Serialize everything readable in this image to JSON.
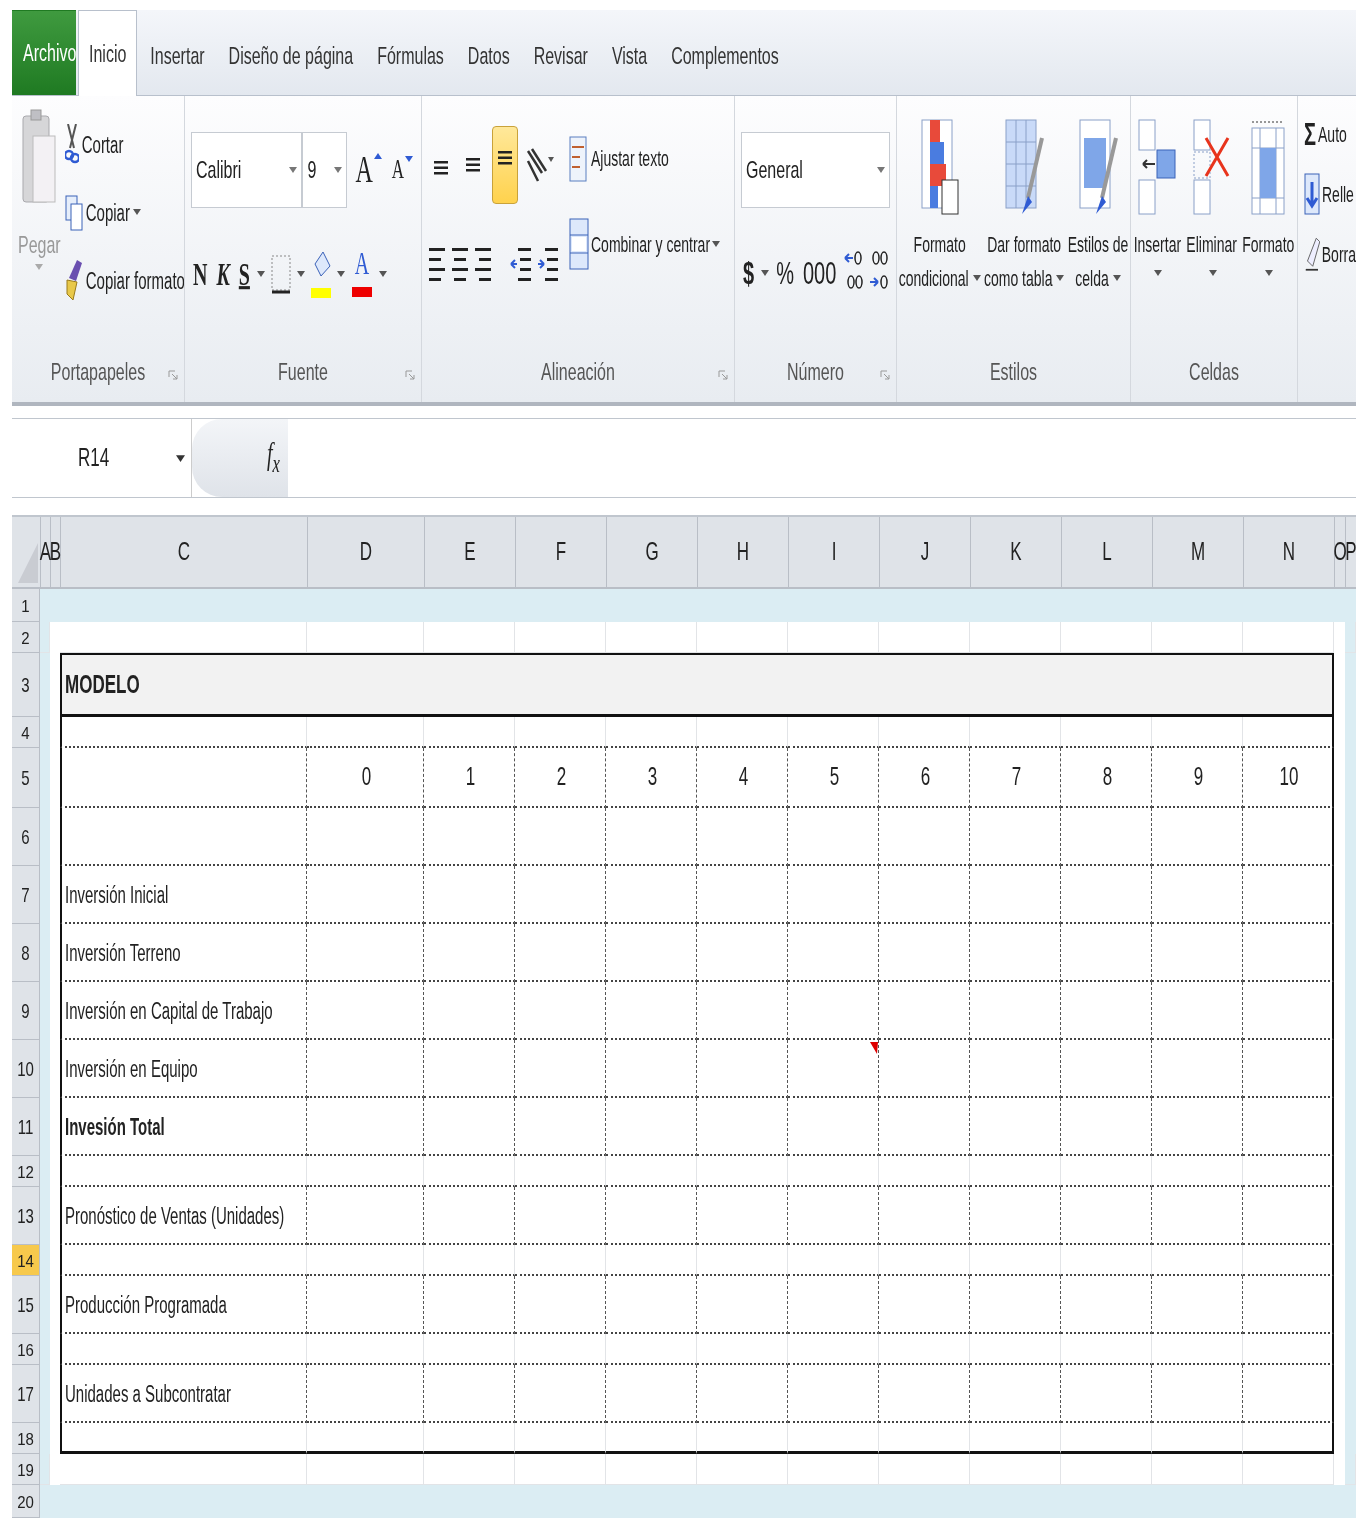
{
  "tabs": [
    {
      "label": "Archivo",
      "kind": "file",
      "selected": false
    },
    {
      "label": "Inicio",
      "kind": "tab",
      "selected": true
    },
    {
      "label": "Insertar",
      "kind": "tab",
      "selected": false
    },
    {
      "label": "Diseño de página",
      "kind": "tab",
      "selected": false
    },
    {
      "label": "Fórmulas",
      "kind": "tab",
      "selected": false
    },
    {
      "label": "Datos",
      "kind": "tab",
      "selected": false
    },
    {
      "label": "Revisar",
      "kind": "tab",
      "selected": false
    },
    {
      "label": "Vista",
      "kind": "tab",
      "selected": false
    },
    {
      "label": "Complementos",
      "kind": "tab",
      "selected": false
    }
  ],
  "ribbon": {
    "clipboard": {
      "label": "Portapapeles",
      "paste": "Pegar",
      "cut": "Cortar",
      "copy": "Copiar",
      "format_painter": "Copiar formato"
    },
    "font": {
      "label": "Fuente",
      "family": "Calibri",
      "size": "9",
      "grow": "A",
      "shrink": "A",
      "bold": "N",
      "italic": "K",
      "underline": "S",
      "font_color": "A"
    },
    "alignment": {
      "label": "Alineación",
      "wrap": "Ajustar texto",
      "merge": "Combinar y centrar",
      "vertical_align": [
        {
          "selected": false
        },
        {
          "selected": false
        },
        {
          "selected": true
        }
      ]
    },
    "number": {
      "label": "Número",
      "format": "General",
      "currency": "$",
      "percent": "%",
      "thousands": "000"
    },
    "styles": {
      "label": "Estilos",
      "buttons": [
        {
          "line1": "Formato",
          "line2": "condicional",
          "kind": "conditional"
        },
        {
          "line1": "Dar formato",
          "line2": "como tabla",
          "kind": "table"
        },
        {
          "line1": "Estilos de",
          "line2": "celda",
          "kind": "cell"
        }
      ]
    },
    "cells": {
      "label": "Celdas",
      "buttons": [
        {
          "label": "Insertar",
          "kind": "insert"
        },
        {
          "label": "Eliminar",
          "kind": "delete"
        },
        {
          "label": "Formato",
          "kind": "format"
        }
      ]
    },
    "editing": {
      "autosum_symbol": "Σ",
      "autosum": "Auto",
      "fill": "Relle",
      "clear": "Borra"
    }
  },
  "formula_bar": {
    "name_box": "R14",
    "fx": "f$_{x}$"
  },
  "columns": [
    {
      "label": "A"
    },
    {
      "label": "B"
    },
    {
      "label": "C"
    },
    {
      "label": "D"
    },
    {
      "label": "E"
    },
    {
      "label": "F"
    },
    {
      "label": "G"
    },
    {
      "label": "H"
    },
    {
      "label": "I"
    },
    {
      "label": "J"
    },
    {
      "label": "K"
    },
    {
      "label": "L"
    },
    {
      "label": "M"
    },
    {
      "label": "N"
    },
    {
      "label": "O"
    },
    {
      "label": "P"
    }
  ],
  "rows": [
    {
      "num": "1",
      "kind": "band",
      "selected": false
    },
    {
      "num": "2",
      "kind": "plain",
      "selected": false
    },
    {
      "num": "3",
      "kind": "title",
      "label": "MODELO",
      "selected": false
    },
    {
      "num": "4",
      "kind": "gap",
      "selected": false
    },
    {
      "num": "5",
      "kind": "numbers",
      "values": [
        "0",
        "1",
        "2",
        "3",
        "4",
        "5",
        "6",
        "7",
        "8",
        "9",
        "10"
      ],
      "selected": false
    },
    {
      "num": "6",
      "kind": "data",
      "selected": false
    },
    {
      "num": "7",
      "kind": "data",
      "label": "Inversión Inicial",
      "selected": false
    },
    {
      "num": "8",
      "kind": "data",
      "label": "Inversión Terreno",
      "selected": false
    },
    {
      "num": "9",
      "kind": "data",
      "label": "Inversión en Capital de Trabajo",
      "selected": false
    },
    {
      "num": "10",
      "kind": "data",
      "label": "Inversión en Equipo",
      "comments": [
        false,
        false,
        false,
        false,
        false,
        true,
        false,
        false,
        false,
        false,
        false
      ],
      "selected": false
    },
    {
      "num": "11",
      "kind": "data",
      "label": "Invesión Total",
      "bold": true,
      "selected": false
    },
    {
      "num": "12",
      "kind": "gap",
      "selected": false
    },
    {
      "num": "13",
      "kind": "data",
      "label": "Pronóstico de Ventas (Unidades)",
      "selected": false
    },
    {
      "num": "14",
      "kind": "gap",
      "selected": true
    },
    {
      "num": "15",
      "kind": "data",
      "label": "Producción Programada",
      "selected": false
    },
    {
      "num": "16",
      "kind": "gap",
      "selected": false
    },
    {
      "num": "17",
      "kind": "data",
      "label": "Unidades a Subcontratar",
      "selected": false
    },
    {
      "num": "18",
      "kind": "last",
      "selected": false
    },
    {
      "num": "19",
      "kind": "plain",
      "selected": false
    },
    {
      "num": "20",
      "kind": "band",
      "selected": false
    }
  ]
}
